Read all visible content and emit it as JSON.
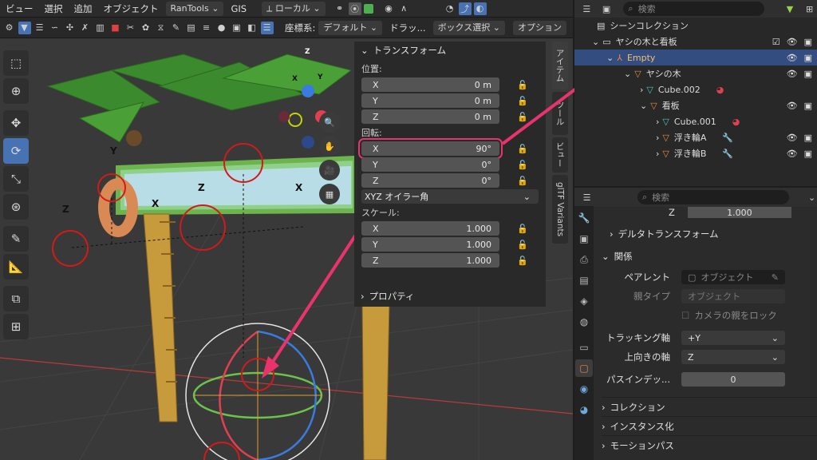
{
  "topbar": {
    "menus": [
      "ビュー",
      "選択",
      "追加",
      "オブジェクト"
    ],
    "addon": "RanTools",
    "gis": "GIS",
    "transform_orientation": "ローカル"
  },
  "header": {
    "coord_label": "座標系:",
    "coord_value": "デフォルト",
    "drag_label": "ドラッ...",
    "box_select": "ボックス選択",
    "options": "オプション"
  },
  "gizmo": {
    "z": "Z",
    "y": "Y",
    "x": "X"
  },
  "viewport_labels": {
    "y": "Y",
    "z": "Z",
    "x": "X",
    "z2": "Z",
    "x2": "X"
  },
  "npanel": {
    "transform": "トランスフォーム",
    "location_label": "位置:",
    "location": [
      {
        "axis": "X",
        "value": "0 m"
      },
      {
        "axis": "Y",
        "value": "0 m"
      },
      {
        "axis": "Z",
        "value": "0 m"
      }
    ],
    "rotation_label": "回転:",
    "rotation": [
      {
        "axis": "X",
        "value": "90°"
      },
      {
        "axis": "Y",
        "value": "0°"
      },
      {
        "axis": "Z",
        "value": "0°"
      }
    ],
    "rotation_mode": "XYZ オイラー角",
    "scale_label": "スケール:",
    "scale": [
      {
        "axis": "X",
        "value": "1.000"
      },
      {
        "axis": "Y",
        "value": "1.000"
      },
      {
        "axis": "Z",
        "value": "1.000"
      }
    ],
    "properties": "プロパティ"
  },
  "vtabs": [
    "アイテム",
    "ツール",
    "ビュー",
    "glTF Variants"
  ],
  "outliner": {
    "search_placeholder": "検索",
    "scene_collection": "シーンコレクション",
    "rows": [
      {
        "name": "ヤシの木と看板"
      },
      {
        "name": "Empty"
      },
      {
        "name": "ヤシの木"
      },
      {
        "name": "Cube.002"
      },
      {
        "name": "看板"
      },
      {
        "name": "Cube.001"
      },
      {
        "name": "浮き輪A"
      },
      {
        "name": "浮き輪B"
      }
    ]
  },
  "properties": {
    "search_placeholder": "検索",
    "top_field": "1.000",
    "top_axis": "Z",
    "delta_transform": "デルタトランスフォーム",
    "relations": "関係",
    "parent_label": "ペアレント",
    "parent_placeholder": "オブジェクト",
    "parent_type_label": "親タイプ",
    "parent_type_value": "オブジェクト",
    "camera_lock": "カメラの親をロック",
    "track_axis_label": "トラッキング軸",
    "track_axis_value": "+Y",
    "up_axis_label": "上向きの軸",
    "up_axis_value": "Z",
    "pass_index_label": "パスインデッ...",
    "pass_index_value": "0",
    "collections": "コレクション",
    "instancing": "インスタンス化",
    "motion_paths": "モーションパス"
  },
  "colors": {
    "accent": "#4772b3",
    "highlight": "#e8336d",
    "ring": "#d11a1a",
    "selected_row": "#334d80"
  }
}
